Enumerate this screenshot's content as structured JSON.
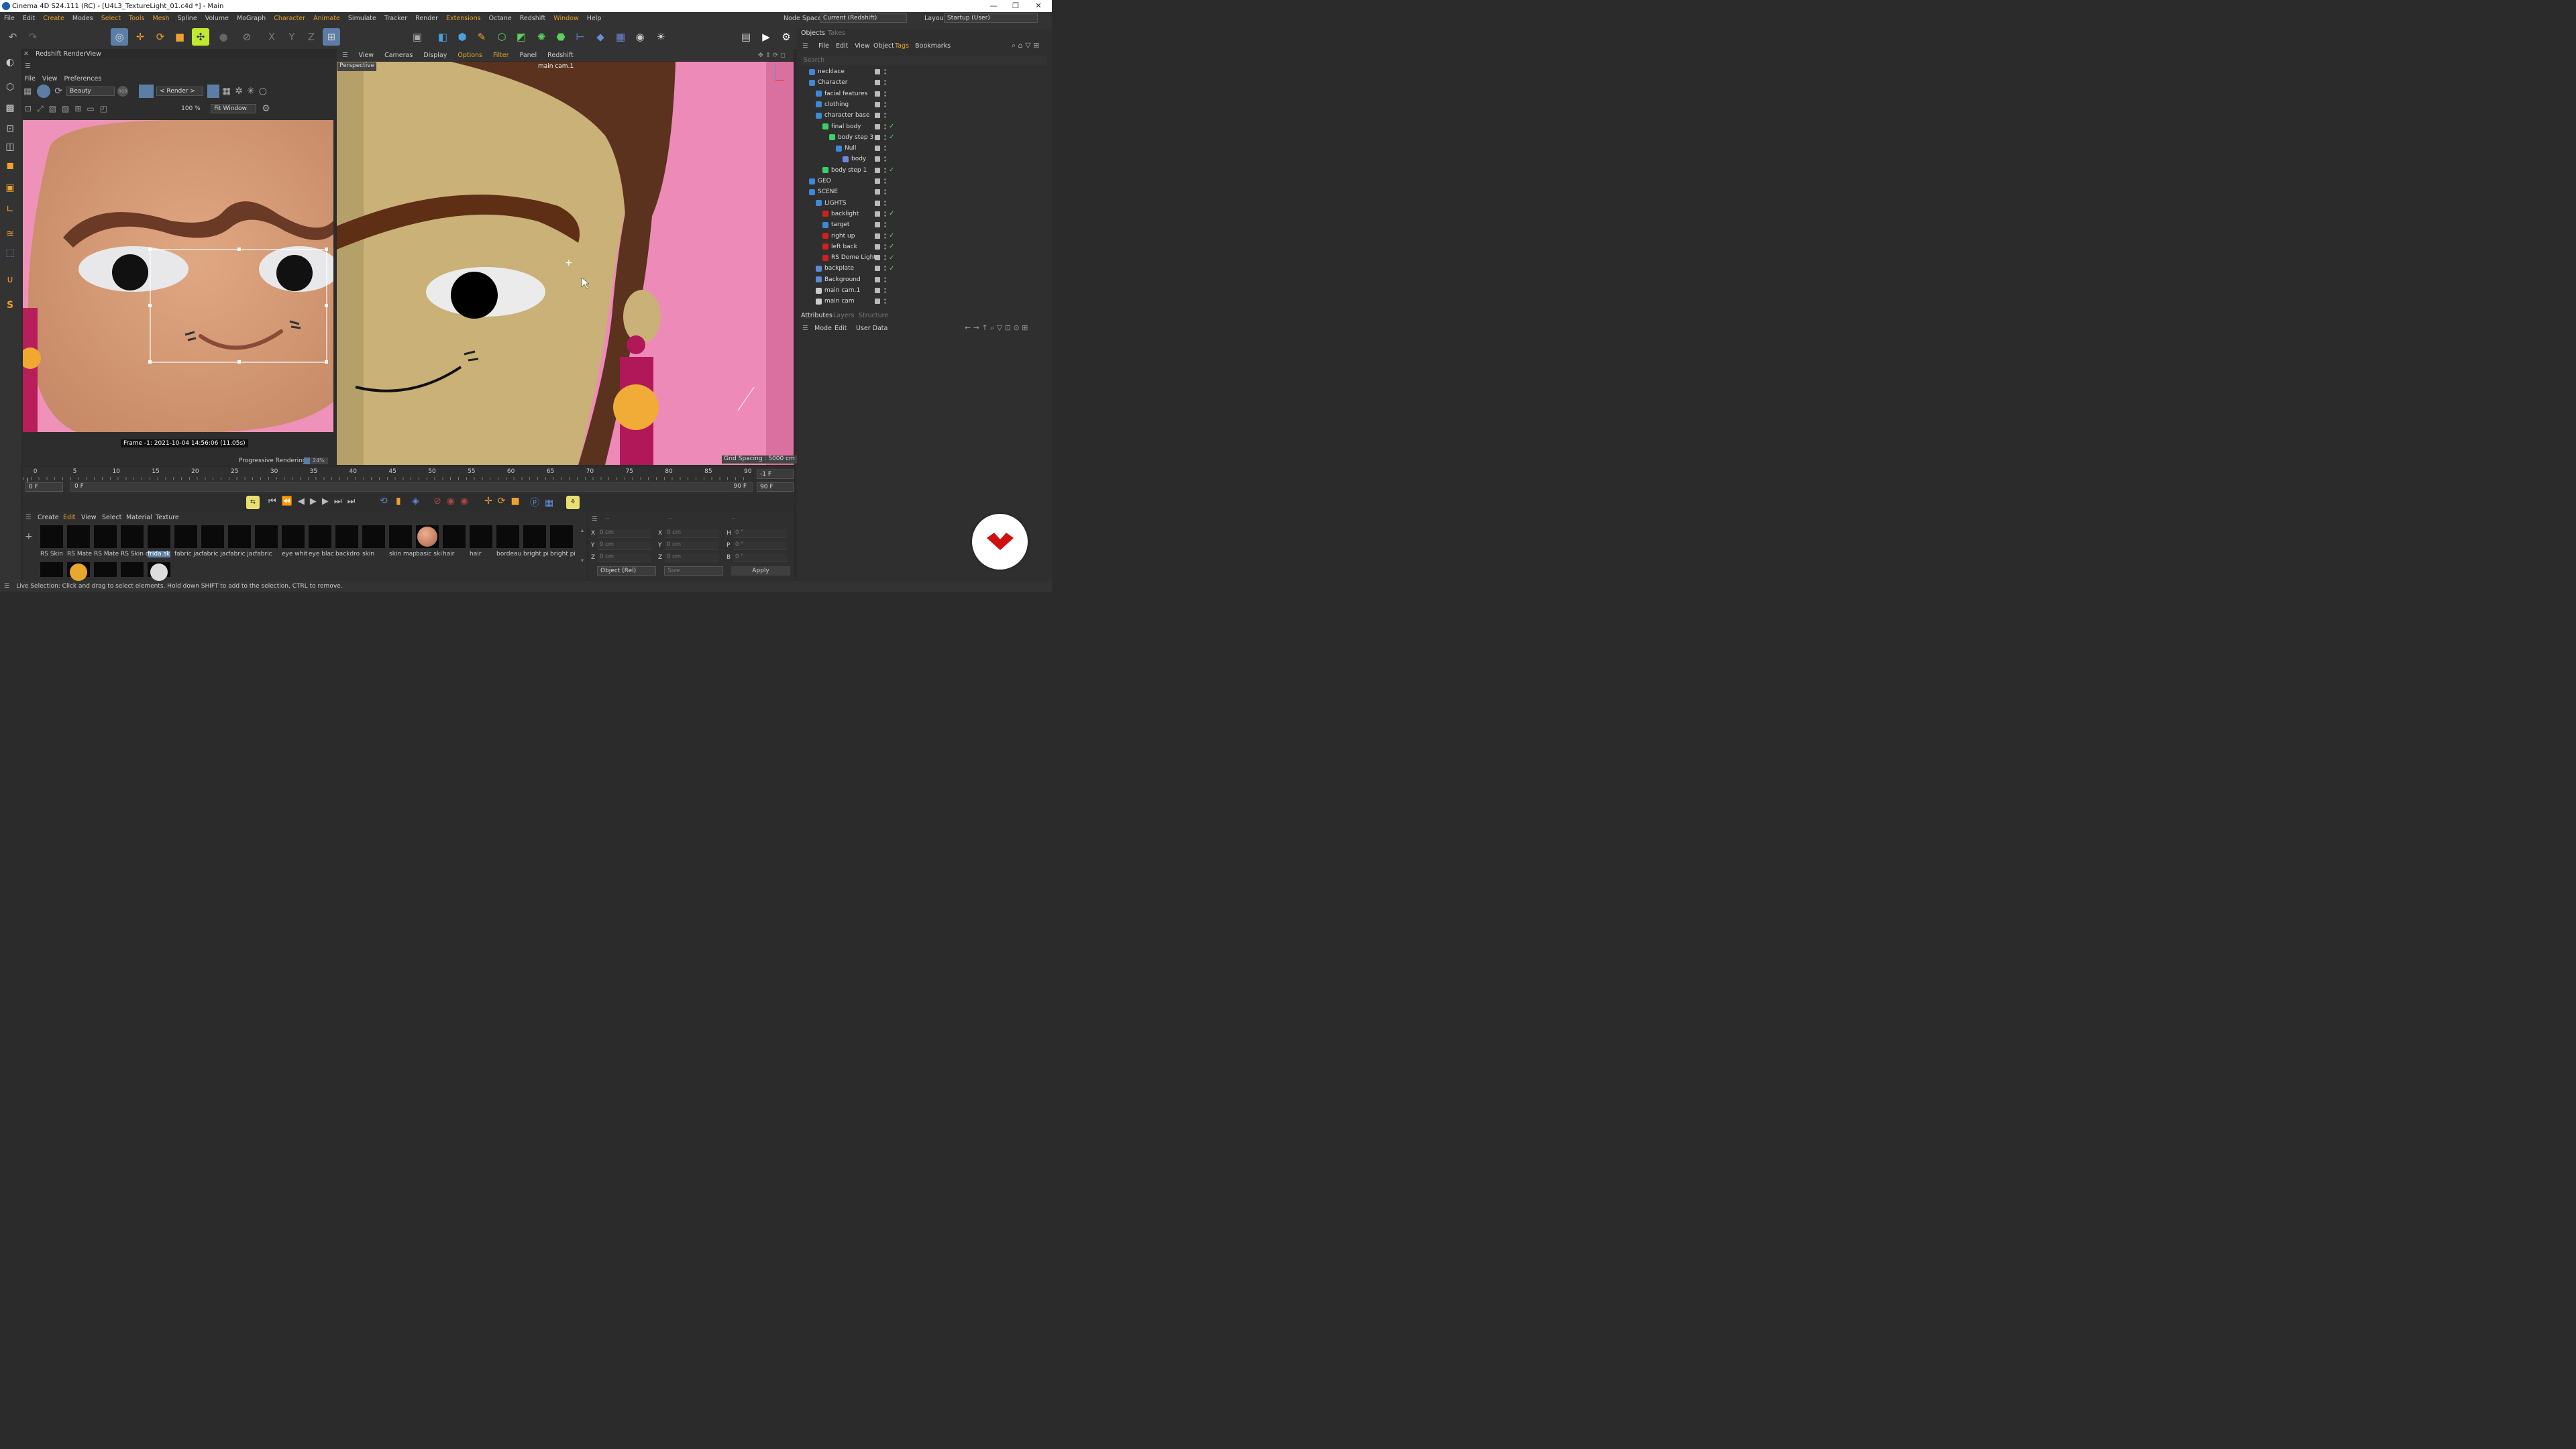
{
  "window": {
    "title": "Cinema 4D S24.111 (RC) - [U4L3_TextureLight_01.c4d *] - Main",
    "minimize": "—",
    "maximize": "❐",
    "close": "✕"
  },
  "menubar": {
    "items": [
      "File",
      "Edit",
      "Create",
      "Modes",
      "Select",
      "Tools",
      "Mesh",
      "Spline",
      "Volume",
      "MoGraph",
      "Character",
      "Animate",
      "Simulate",
      "Tracker",
      "Render",
      "Extensions",
      "Octane",
      "Redshift",
      "Window",
      "Help"
    ],
    "node_space_label": "Node Space:",
    "node_space_value": "Current (Redshift)",
    "layout_label": "Layout:",
    "layout_value": "Startup (User)"
  },
  "toolbar_axes": {
    "x": "X",
    "y": "Y",
    "z": "Z"
  },
  "renderview": {
    "title": "Redshift RenderView",
    "menu": [
      "File",
      "View",
      "Preferences"
    ],
    "aov": "Beauty",
    "rgb_label": "RGB",
    "render_target": "< Render >",
    "zoom": "100 %",
    "fit": "Fit Window",
    "frame_info": "Frame  -1:  2021-10-04  14:56:06  (11.05s)",
    "progress_label": "Progressive Rendering...",
    "progress_percent": "24%",
    "progress_value": 0.24
  },
  "viewport": {
    "menu": [
      "View",
      "Cameras",
      "Display",
      "Options",
      "Filter",
      "Panel",
      "Redshift"
    ],
    "label": "Perspective",
    "camera": "main cam.1",
    "grid": "Grid Spacing : 5000 cm"
  },
  "objects_panel": {
    "tabs": [
      "Objects",
      "Takes"
    ],
    "menu": [
      "File",
      "Edit",
      "View",
      "Object",
      "Tags",
      "Bookmarks"
    ],
    "search_placeholder": "Search",
    "rows": [
      {
        "name": "necklace",
        "check": ""
      },
      {
        "name": "Character",
        "check": ""
      },
      {
        "name": "facial features",
        "check": ""
      },
      {
        "name": "clothing",
        "check": ""
      },
      {
        "name": "character base",
        "check": ""
      },
      {
        "name": "final body",
        "check": "✓"
      },
      {
        "name": "body step 3",
        "check": "✓"
      },
      {
        "name": "Null",
        "check": ""
      },
      {
        "name": "body",
        "check": ""
      },
      {
        "name": "body step 1",
        "check": "✓"
      },
      {
        "name": "GEO",
        "check": ""
      },
      {
        "name": "SCENE",
        "check": ""
      },
      {
        "name": "LIGHTS",
        "check": ""
      },
      {
        "name": "backlight",
        "check": "✓"
      },
      {
        "name": "target",
        "check": ""
      },
      {
        "name": "right up",
        "check": "✓"
      },
      {
        "name": "left back",
        "check": "✓"
      },
      {
        "name": "RS Dome Light",
        "check": "✓"
      },
      {
        "name": "backplate",
        "check": "✓"
      },
      {
        "name": "Background",
        "check": ""
      },
      {
        "name": "main cam.1",
        "check": ""
      },
      {
        "name": "main cam",
        "check": ""
      }
    ]
  },
  "attributes": {
    "tabs": [
      "Attributes",
      "Layers",
      "Structure"
    ],
    "menu": [
      "Mode",
      "Edit",
      "User Data"
    ]
  },
  "timeline": {
    "ticks": [
      "0",
      "5",
      "10",
      "15",
      "20",
      "25",
      "30",
      "35",
      "40",
      "45",
      "50",
      "55",
      "60",
      "65",
      "70",
      "75",
      "80",
      "85",
      "90"
    ],
    "current_frame": "-1 F",
    "start": "0 F",
    "range_start": "0 F",
    "range_end": "90 F",
    "end": "90 F"
  },
  "materials": {
    "menu": [
      "Create",
      "Edit",
      "View",
      "Select",
      "Material",
      "Texture"
    ],
    "items": [
      "RS Skin",
      "RS Mate",
      "RS Mate",
      "RS Skin c",
      "frida skir",
      "fabric jac",
      "fabric jac",
      "fabric jac",
      "fabric",
      "eye whit",
      "eye blac",
      "backdro",
      "skin",
      "skin map",
      "basic ski",
      "hair",
      "hair",
      "bordeau",
      "bright pi",
      "bright pi"
    ],
    "selected": "frida skir"
  },
  "coordinates": {
    "headers": [
      "--",
      "--",
      "--"
    ],
    "pos_labels": [
      "X",
      "Y",
      "Z"
    ],
    "size_labels": [
      "X",
      "Y",
      "Z"
    ],
    "rot_labels": [
      "H",
      "P",
      "B"
    ],
    "pos": [
      "0 cm",
      "0 cm",
      "0 cm"
    ],
    "size": [
      "0 cm",
      "0 cm",
      "0 cm"
    ],
    "rot": [
      "0 °",
      "0 °",
      "0 °"
    ],
    "mode": "Object (Rel)",
    "size_mode": "Size",
    "apply": "Apply"
  },
  "status": "Live Selection: Click and drag to select elements. Hold down SHIFT to add to the selection, CTRL to remove."
}
